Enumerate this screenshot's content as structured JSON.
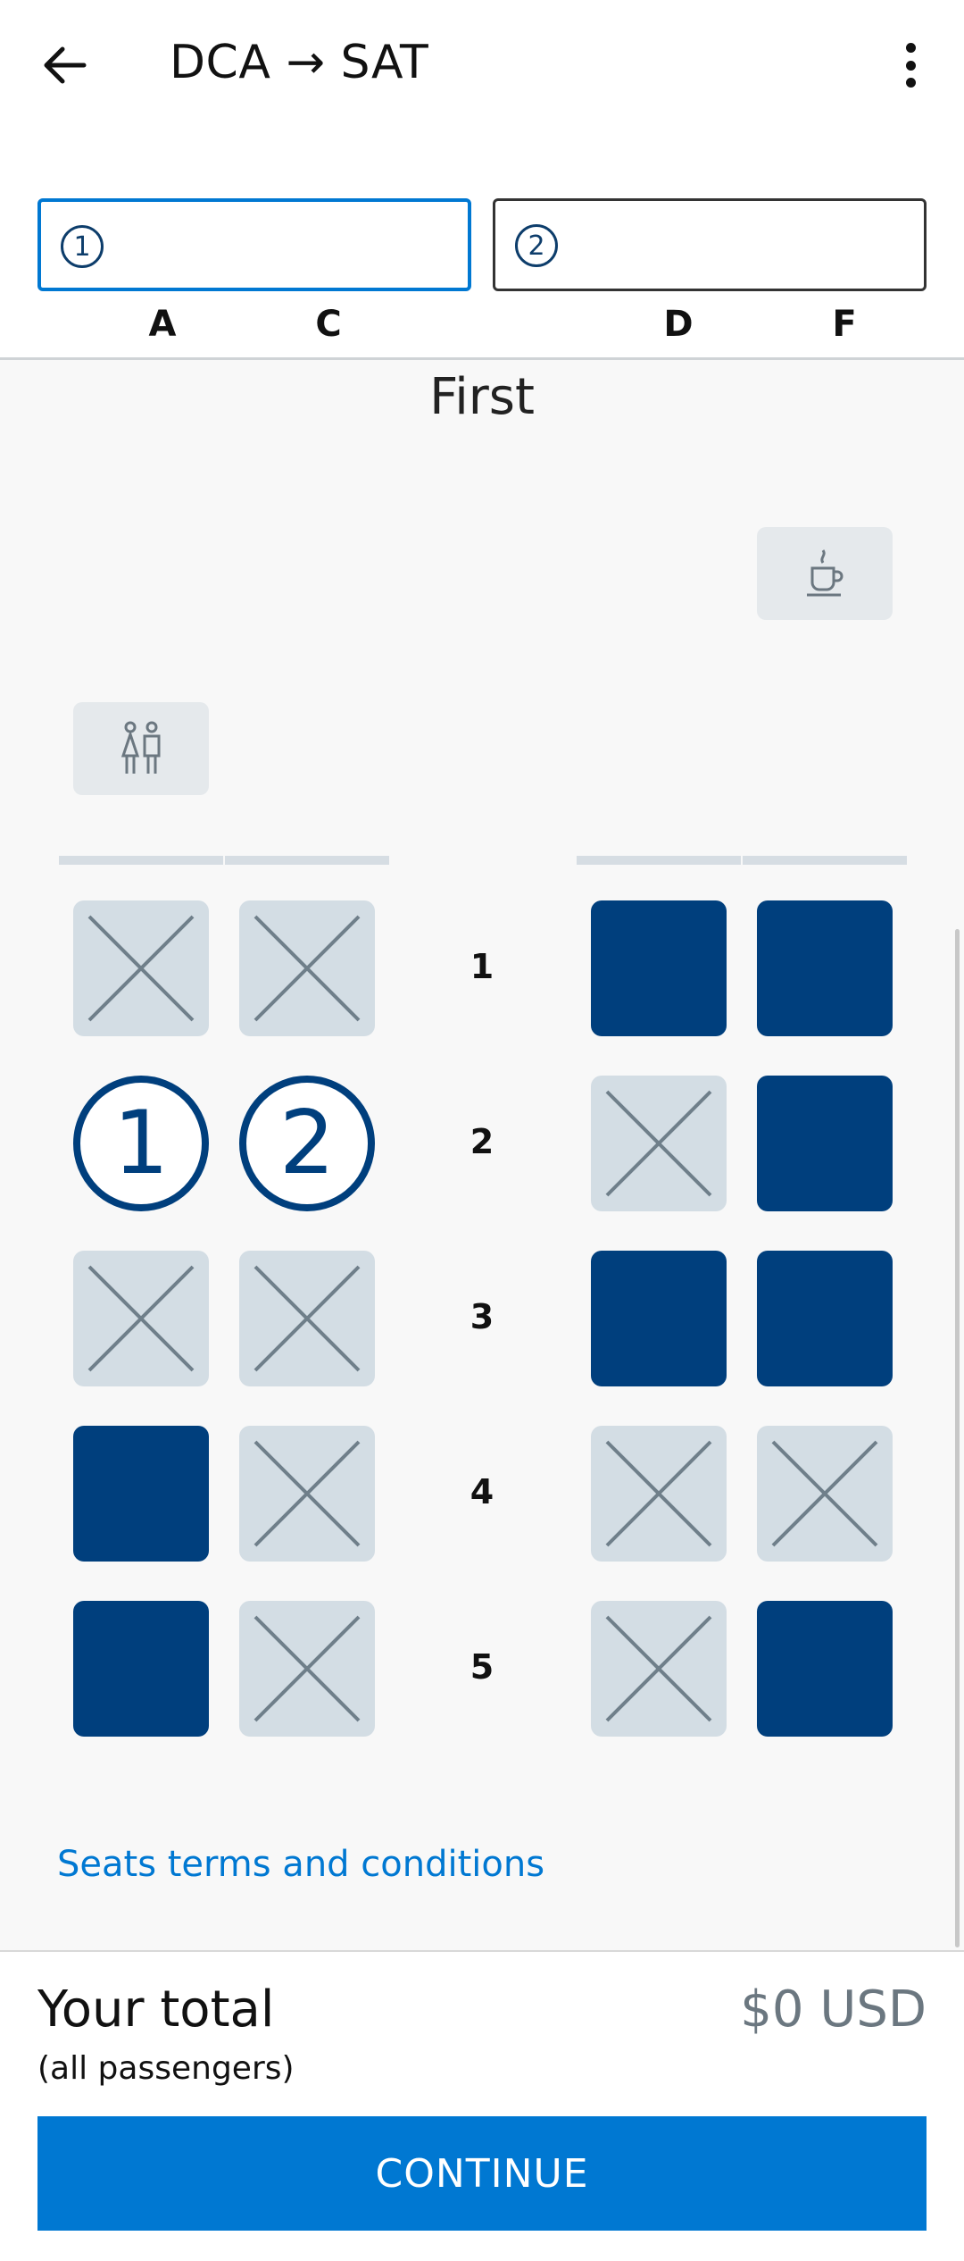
{
  "header": {
    "title": "DCA → SAT",
    "back_icon": "arrow-left-icon",
    "menu_icon": "more-vertical-icon"
  },
  "passengers": [
    {
      "number": "1"
    },
    {
      "number": "2"
    }
  ],
  "columns": [
    "A",
    "C",
    "D",
    "F"
  ],
  "cabin": "First",
  "amenities": {
    "galley_icon": "coffee-cup-icon",
    "lavatory_icon": "restroom-icon"
  },
  "rows": [
    {
      "number": "1",
      "seats": [
        "taken",
        "taken",
        "available",
        "available"
      ]
    },
    {
      "number": "2",
      "seats": [
        "selected-1",
        "selected-2",
        "taken",
        "available"
      ]
    },
    {
      "number": "3",
      "seats": [
        "taken",
        "taken",
        "available",
        "available"
      ]
    },
    {
      "number": "4",
      "seats": [
        "available",
        "taken",
        "taken",
        "taken"
      ]
    },
    {
      "number": "5",
      "seats": [
        "available",
        "taken",
        "taken",
        "available"
      ]
    }
  ],
  "selected_labels": {
    "1": "1",
    "2": "2"
  },
  "terms_link": "Seats terms and conditions",
  "footer": {
    "total_label": "Your total",
    "total_sub": "(all passengers)",
    "total_value": "$0 USD",
    "continue_label": "CONTINUE"
  },
  "colors": {
    "primary": "#0078d2",
    "seat_available": "#003f7d",
    "seat_taken": "#d3dde4"
  }
}
